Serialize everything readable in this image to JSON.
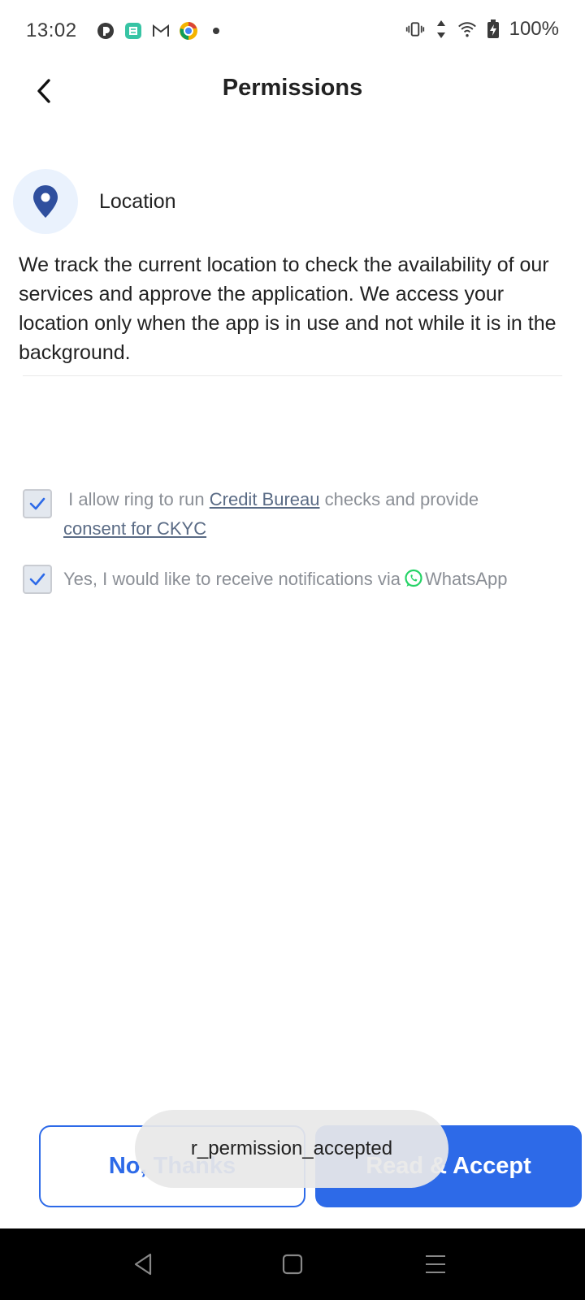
{
  "status_bar": {
    "time": "13:02",
    "battery": "100%",
    "left_icons": [
      "notification-app-icon",
      "calculator-app-icon",
      "gmail-icon",
      "chrome-icon",
      "more-dot-icon"
    ],
    "right_icons": [
      "vibrate-icon",
      "data-arrows-icon",
      "wifi-icon",
      "battery-charging-icon"
    ]
  },
  "header": {
    "title": "Permissions"
  },
  "permission": {
    "title": "Location",
    "icon": "location-pin-icon",
    "description": "We track the current location to check the availability of our services and approve the application. We access your location only when the app is in use and not while it is in the background."
  },
  "consents": {
    "credit": {
      "checked": true,
      "prefix": " I allow ring to run ",
      "link1": "Credit Bureau",
      "middle": " checks and provide ",
      "link2": "consent for CKYC"
    },
    "whatsapp": {
      "checked": true,
      "prefix": "Yes, I would like to receive notifications via",
      "brand": "WhatsApp"
    }
  },
  "buttons": {
    "decline": "No, Thanks",
    "accept": "Read & Accept"
  },
  "toast": {
    "text": "r_permission_accepted"
  },
  "nav": {
    "icons": [
      "back-triangle-icon",
      "home-square-icon",
      "menu-lines-icon"
    ]
  },
  "colors": {
    "accent": "#2d6ae8",
    "pin": "#2f4f9e",
    "pin_bg": "#eaf2fd",
    "whatsapp": "#25d366"
  }
}
